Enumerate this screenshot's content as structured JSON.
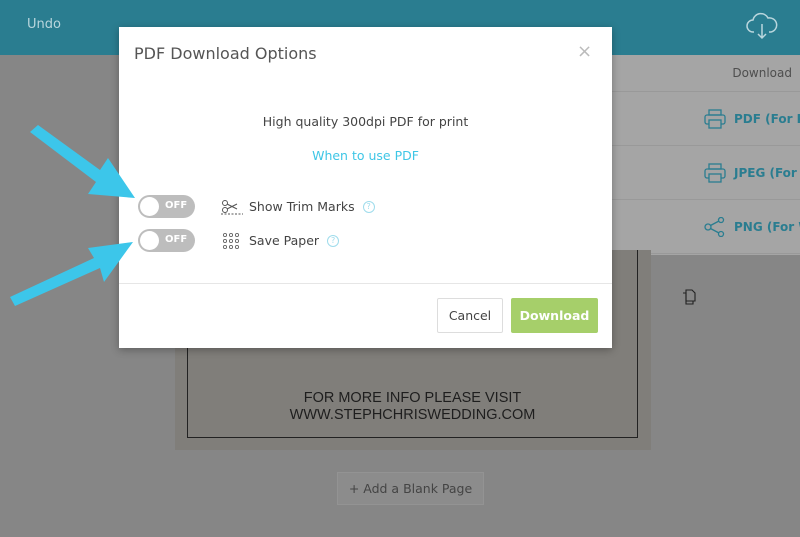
{
  "topbar": {
    "undo_label": "Undo",
    "download_icon": "cloud-download-icon"
  },
  "dropdown": {
    "header": "Download",
    "items": [
      {
        "label": "PDF (For Print)",
        "icon": "printer-icon"
      },
      {
        "label": "JPEG (For Print)",
        "icon": "printer-icon"
      },
      {
        "label": "PNG (For Web)",
        "icon": "share-icon"
      }
    ]
  },
  "card": {
    "line1": "FOR MORE INFO PLEASE VISIT",
    "line2": "WWW.STEPHCHRISWEDDING.COM"
  },
  "add_page_label": "+ Add a Blank Page",
  "modal": {
    "title": "PDF Download Options",
    "close": "×",
    "description": "High quality 300dpi PDF for print",
    "link": "When to use PDF",
    "options": [
      {
        "label": "Show Trim Marks",
        "state": "OFF",
        "icon": "scissors-icon"
      },
      {
        "label": "Save Paper",
        "state": "OFF",
        "icon": "grid-dots-icon"
      }
    ],
    "help": "?",
    "cancel": "Cancel",
    "download": "Download"
  },
  "colors": {
    "accent": "#3ec6e6",
    "download_button": "#a6cf6a",
    "arrow": "#3cc6ea",
    "topbar": "#2a7d90"
  }
}
